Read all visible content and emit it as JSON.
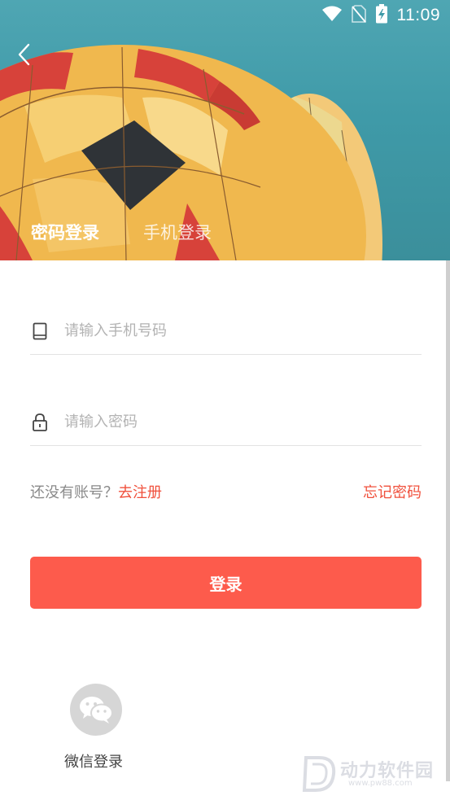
{
  "status_bar": {
    "time": "11:09"
  },
  "tabs": [
    {
      "label": "密码登录",
      "active": true
    },
    {
      "label": "手机登录",
      "active": false
    }
  ],
  "phone_field": {
    "placeholder": "请输入手机号码",
    "value": "",
    "icon": "phone-icon"
  },
  "password_field": {
    "placeholder": "请输入密码",
    "value": "",
    "icon": "lock-icon"
  },
  "links": {
    "no_account": "还没有账号？",
    "register": "去注册",
    "forgot_password": "忘记密码"
  },
  "login_button": {
    "label": "登录"
  },
  "wechat_login": {
    "label": "微信登录",
    "icon": "wechat-icon"
  },
  "watermark": {
    "text": "动力软件园",
    "url": "www.pw88.com"
  },
  "colors": {
    "accent": "#fd5b4c",
    "link": "#f0503c",
    "placeholder": "#b3b3b3"
  }
}
